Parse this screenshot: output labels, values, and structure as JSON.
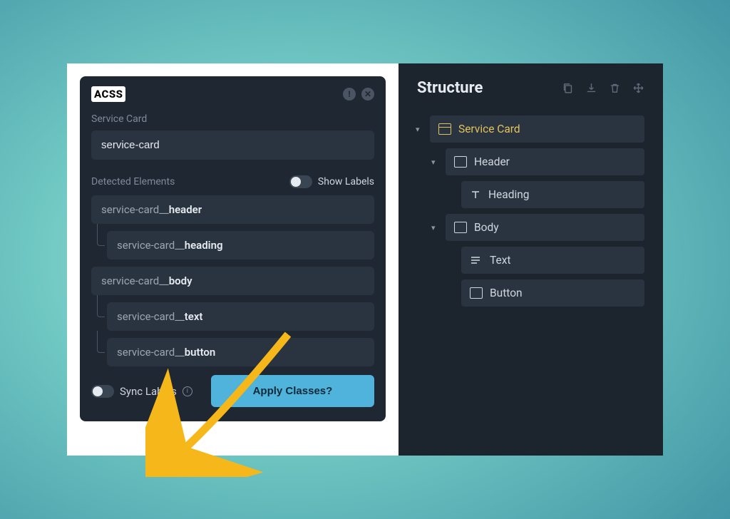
{
  "acss": {
    "logo": "ACSS",
    "card_title": "Service Card",
    "card_value": "service-card",
    "detected_label": "Detected Elements",
    "show_labels_label": "Show Labels",
    "elements": [
      {
        "prefix": "service-card__",
        "suffix": "header",
        "indent": 0
      },
      {
        "prefix": "service-card__",
        "suffix": "heading",
        "indent": 1
      },
      {
        "prefix": "service-card__",
        "suffix": "body",
        "indent": 0
      },
      {
        "prefix": "service-card__",
        "suffix": "text",
        "indent": 1
      },
      {
        "prefix": "service-card__",
        "suffix": "button",
        "indent": 1
      }
    ],
    "sync_label": "Sync Labels",
    "apply_label": "Apply Classes?"
  },
  "structure": {
    "title": "Structure",
    "tree": [
      {
        "label": "Service Card",
        "level": 0,
        "icon": "box-top",
        "selected": true,
        "chevron": true
      },
      {
        "label": "Header",
        "level": 1,
        "icon": "box-plain",
        "selected": false,
        "chevron": true
      },
      {
        "label": "Heading",
        "level": 2,
        "icon": "text-t",
        "selected": false,
        "chevron": false
      },
      {
        "label": "Body",
        "level": 1,
        "icon": "box-plain",
        "selected": false,
        "chevron": true
      },
      {
        "label": "Text",
        "level": 2,
        "icon": "lines",
        "selected": false,
        "chevron": false
      },
      {
        "label": "Button",
        "level": 2,
        "icon": "box-plain",
        "selected": false,
        "chevron": false
      }
    ]
  }
}
